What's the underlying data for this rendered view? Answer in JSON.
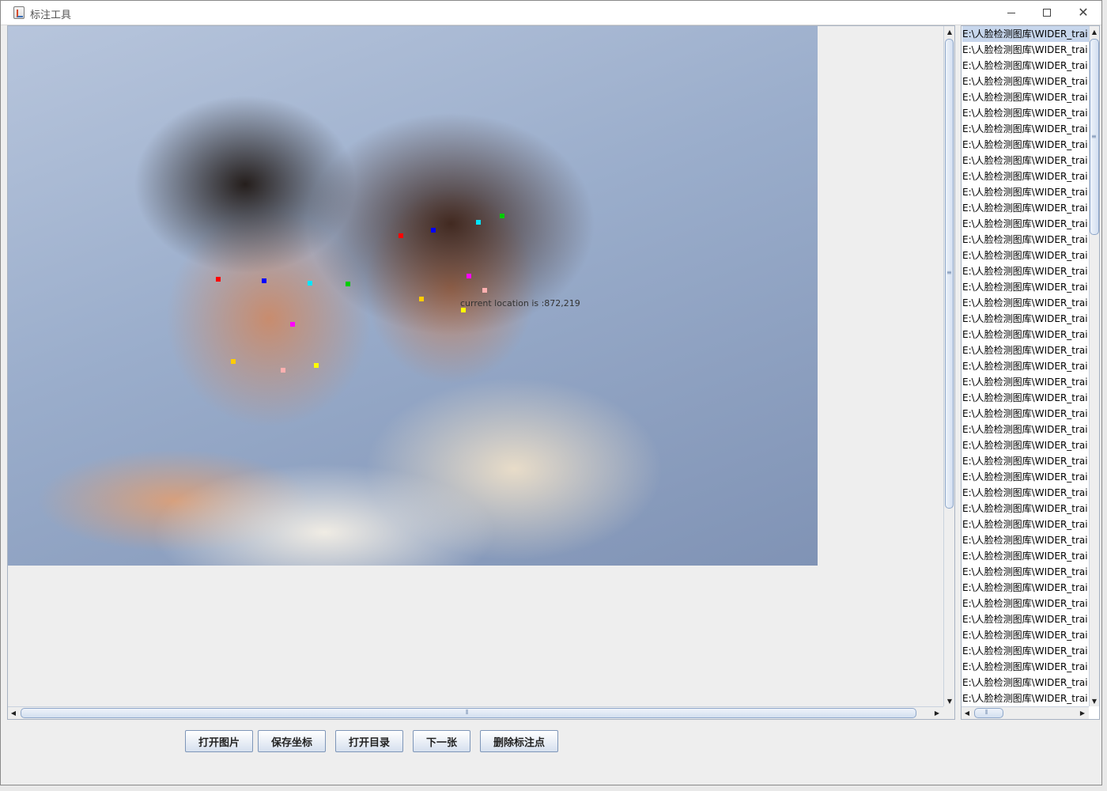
{
  "window": {
    "title": "标注工具"
  },
  "photo": {
    "cursor_label": "current location is :872,219",
    "keypoints": [
      {
        "color": "#ff0000"
      },
      {
        "color": "#0000ff"
      },
      {
        "color": "#00e5ff"
      },
      {
        "color": "#00cc00"
      },
      {
        "color": "#ff00ff"
      },
      {
        "color": "#ffcc00"
      },
      {
        "color": "#ffb0b0"
      },
      {
        "color": "#ffff00"
      },
      {
        "color": "#ff0000"
      },
      {
        "color": "#0000ff"
      },
      {
        "color": "#00e5ff"
      },
      {
        "color": "#00cc00"
      },
      {
        "color": "#ff00ff"
      },
      {
        "color": "#ffb0b0"
      },
      {
        "color": "#ffcc00"
      },
      {
        "color": "#ffff00"
      }
    ]
  },
  "file_list": {
    "items": [
      "E:\\人脸检测图库\\WIDER_trai",
      "E:\\人脸检测图库\\WIDER_trai",
      "E:\\人脸检测图库\\WIDER_trai",
      "E:\\人脸检测图库\\WIDER_trai",
      "E:\\人脸检测图库\\WIDER_trai",
      "E:\\人脸检测图库\\WIDER_trai",
      "E:\\人脸检测图库\\WIDER_trai",
      "E:\\人脸检测图库\\WIDER_trai",
      "E:\\人脸检测图库\\WIDER_trai",
      "E:\\人脸检测图库\\WIDER_trai",
      "E:\\人脸检测图库\\WIDER_trai",
      "E:\\人脸检测图库\\WIDER_trai",
      "E:\\人脸检测图库\\WIDER_trai",
      "E:\\人脸检测图库\\WIDER_trai",
      "E:\\人脸检测图库\\WIDER_trai",
      "E:\\人脸检测图库\\WIDER_trai",
      "E:\\人脸检测图库\\WIDER_trai",
      "E:\\人脸检测图库\\WIDER_trai",
      "E:\\人脸检测图库\\WIDER_trai",
      "E:\\人脸检测图库\\WIDER_trai",
      "E:\\人脸检测图库\\WIDER_trai",
      "E:\\人脸检测图库\\WIDER_trai",
      "E:\\人脸检测图库\\WIDER_trai",
      "E:\\人脸检测图库\\WIDER_trai",
      "E:\\人脸检测图库\\WIDER_trai",
      "E:\\人脸检测图库\\WIDER_trai",
      "E:\\人脸检测图库\\WIDER_trai",
      "E:\\人脸检测图库\\WIDER_trai",
      "E:\\人脸检测图库\\WIDER_trai",
      "E:\\人脸检测图库\\WIDER_trai",
      "E:\\人脸检测图库\\WIDER_trai",
      "E:\\人脸检测图库\\WIDER_trai",
      "E:\\人脸检测图库\\WIDER_trai",
      "E:\\人脸检测图库\\WIDER_trai",
      "E:\\人脸检测图库\\WIDER_trai",
      "E:\\人脸检测图库\\WIDER_trai",
      "E:\\人脸检测图库\\WIDER_trai",
      "E:\\人脸检测图库\\WIDER_trai",
      "E:\\人脸检测图库\\WIDER_trai",
      "E:\\人脸检测图库\\WIDER_trai",
      "E:\\人脸检测图库\\WIDER_trai",
      "E:\\人脸检测图库\\WIDER_trai",
      "E:\\人脸检测图库\\WIDER_trai"
    ]
  },
  "buttons": {
    "open_image": "打开图片",
    "save_coords": "保存坐标",
    "open_dir": "打开目录",
    "next": "下一张",
    "delete_points": "删除标注点"
  },
  "icons": {
    "app": "java-app-icon",
    "minimize": "minimize-icon",
    "maximize": "maximize-icon",
    "close": "close-icon"
  }
}
